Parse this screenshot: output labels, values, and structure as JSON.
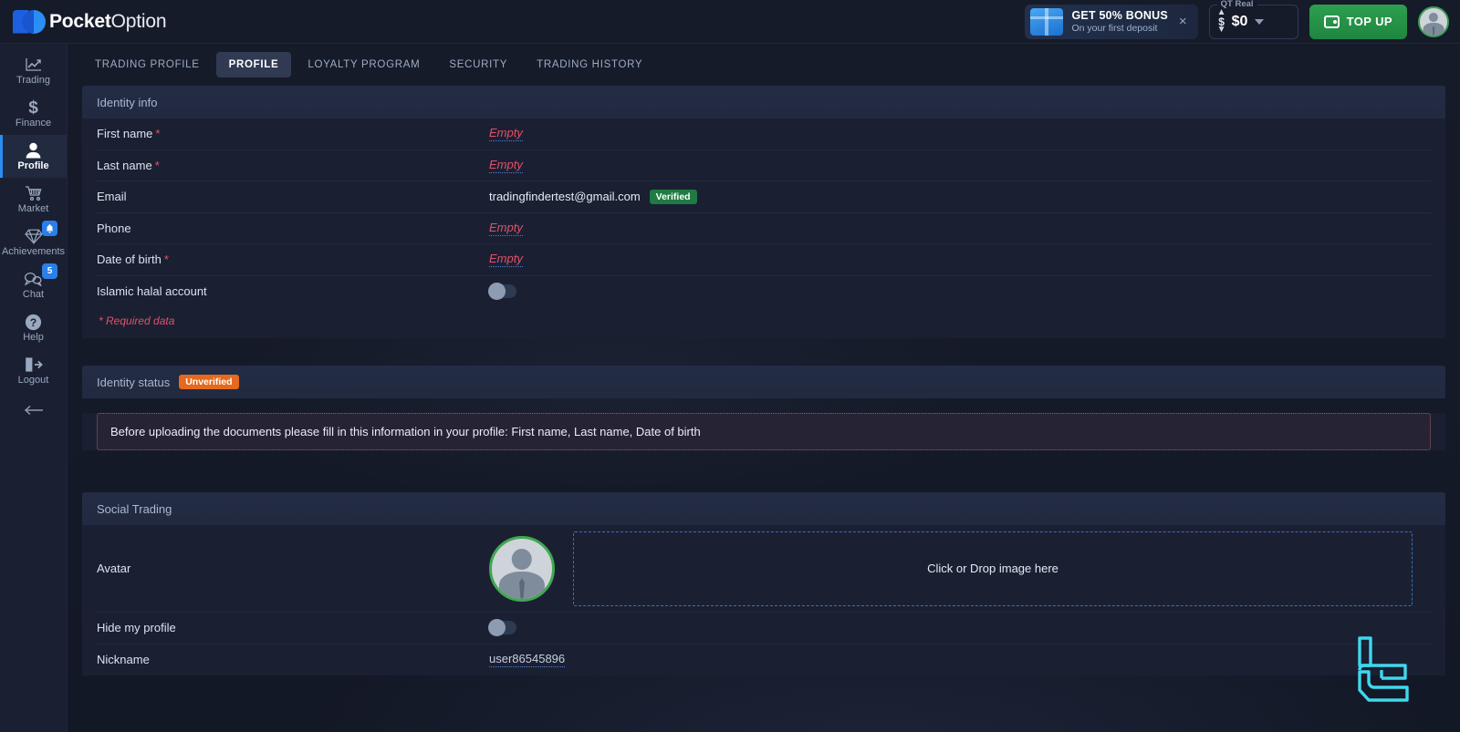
{
  "brand": {
    "name_bold": "Pocket",
    "name_light": "Option",
    "logo_icon": "pocketoption-logo-icon"
  },
  "topbar": {
    "bonus": {
      "icon": "gift-box-icon",
      "title": "GET 50% BONUS",
      "subtitle": "On your first deposit",
      "close_icon": "×"
    },
    "balance": {
      "account_label": "QT Real",
      "amount": "$0",
      "switch_icon": "updown-arrows-icon",
      "dropdown_icon": "chevron-down-icon"
    },
    "topup": {
      "label": "TOP UP",
      "icon": "wallet-icon"
    },
    "avatar_icon": "user-avatar-icon"
  },
  "sidebar": {
    "items": [
      {
        "label": "Trading",
        "icon": "chart-line-icon",
        "active": false,
        "badge": ""
      },
      {
        "label": "Finance",
        "icon": "dollar-icon",
        "active": false,
        "badge": ""
      },
      {
        "label": "Profile",
        "icon": "user-icon",
        "active": true,
        "badge": ""
      },
      {
        "label": "Market",
        "icon": "cart-icon",
        "active": false,
        "badge": ""
      },
      {
        "label": "Achievements",
        "icon": "diamond-icon",
        "active": false,
        "badge": "bell"
      },
      {
        "label": "Chat",
        "icon": "chat-bubble-icon",
        "active": false,
        "badge": "5"
      },
      {
        "label": "Help",
        "icon": "question-circle-icon",
        "active": false,
        "badge": ""
      },
      {
        "label": "Logout",
        "icon": "logout-icon",
        "active": false,
        "badge": ""
      }
    ],
    "collapse_icon": "arrow-left-icon"
  },
  "tabs": [
    {
      "label": "TRADING PROFILE",
      "active": false
    },
    {
      "label": "PROFILE",
      "active": true
    },
    {
      "label": "LOYALTY PROGRAM",
      "active": false
    },
    {
      "label": "SECURITY",
      "active": false
    },
    {
      "label": "TRADING HISTORY",
      "active": false
    }
  ],
  "identity_info": {
    "heading": "Identity info",
    "rows": [
      {
        "label": "First name",
        "required": true,
        "type": "empty",
        "value": "Empty"
      },
      {
        "label": "Last name",
        "required": true,
        "type": "empty",
        "value": "Empty"
      },
      {
        "label": "Email",
        "required": false,
        "type": "text",
        "value": "tradingfindertest@gmail.com",
        "badge": "Verified"
      },
      {
        "label": "Phone",
        "required": false,
        "type": "empty",
        "value": "Empty"
      },
      {
        "label": "Date of birth",
        "required": true,
        "type": "empty",
        "value": "Empty"
      },
      {
        "label": "Islamic halal account",
        "required": false,
        "type": "toggle",
        "value": "off"
      }
    ],
    "required_note": "* Required data"
  },
  "identity_status": {
    "heading": "Identity status",
    "badge": "Unverified",
    "warning": "Before uploading the documents please fill in this information in your profile: First name, Last name, Date of birth"
  },
  "social_trading": {
    "heading": "Social Trading",
    "avatar_label": "Avatar",
    "avatar_icon": "user-avatar-icon",
    "dropzone_text": "Click or Drop image here",
    "hide_profile_label": "Hide my profile",
    "hide_profile_state": "off",
    "nickname_label": "Nickname",
    "nickname_value": "user86545896"
  },
  "watermark": {
    "icon": "tradingfinder-watermark-icon",
    "color": "#3fd8ee"
  },
  "colors": {
    "accent_blue": "#2b8ef5",
    "brand_green": "#1e8640",
    "verified_green": "#1f7a43",
    "unverified_orange": "#e5691e",
    "required_red": "#e0516b",
    "panel_bg": "#1a2032",
    "page_bg": "#151a28",
    "section_head_bg": "#232c44"
  }
}
